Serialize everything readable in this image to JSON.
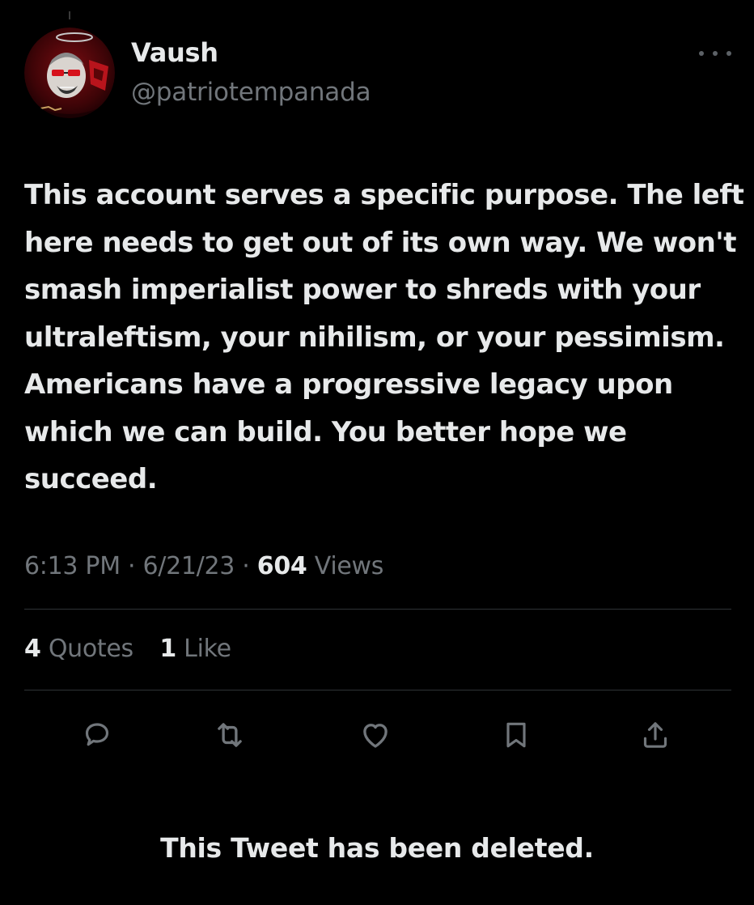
{
  "author": {
    "display_name": "Vaush",
    "handle": "@patriotempanada"
  },
  "tweet": {
    "text": "This account serves a specific purpose. The left here needs to get out of its own way. We won't smash imperialist power to shreds with your ultraleftism, your nihilism, or your pessimism. Americans have a progressive legacy upon which we can build. You better hope we succeed."
  },
  "meta": {
    "time": "6:13 PM",
    "sep1": " · ",
    "date": "6/21/23",
    "sep2": " · ",
    "views_count": "604",
    "views_label": " Views"
  },
  "stats": {
    "quotes_count": "4",
    "quotes_label": " Quotes",
    "likes_count": "1",
    "likes_label": " Like"
  },
  "actions": {
    "reply_icon": "reply-icon",
    "retweet_icon": "retweet-icon",
    "like_icon": "heart-icon",
    "bookmark_icon": "bookmark-icon",
    "share_icon": "share-icon"
  },
  "footer": {
    "deleted_text": "This Tweet has been deleted."
  },
  "colors": {
    "background": "#000000",
    "primary_text": "#e7e9ea",
    "secondary_text": "#71767b",
    "divider": "#2f3336",
    "icon": "#71767b"
  }
}
